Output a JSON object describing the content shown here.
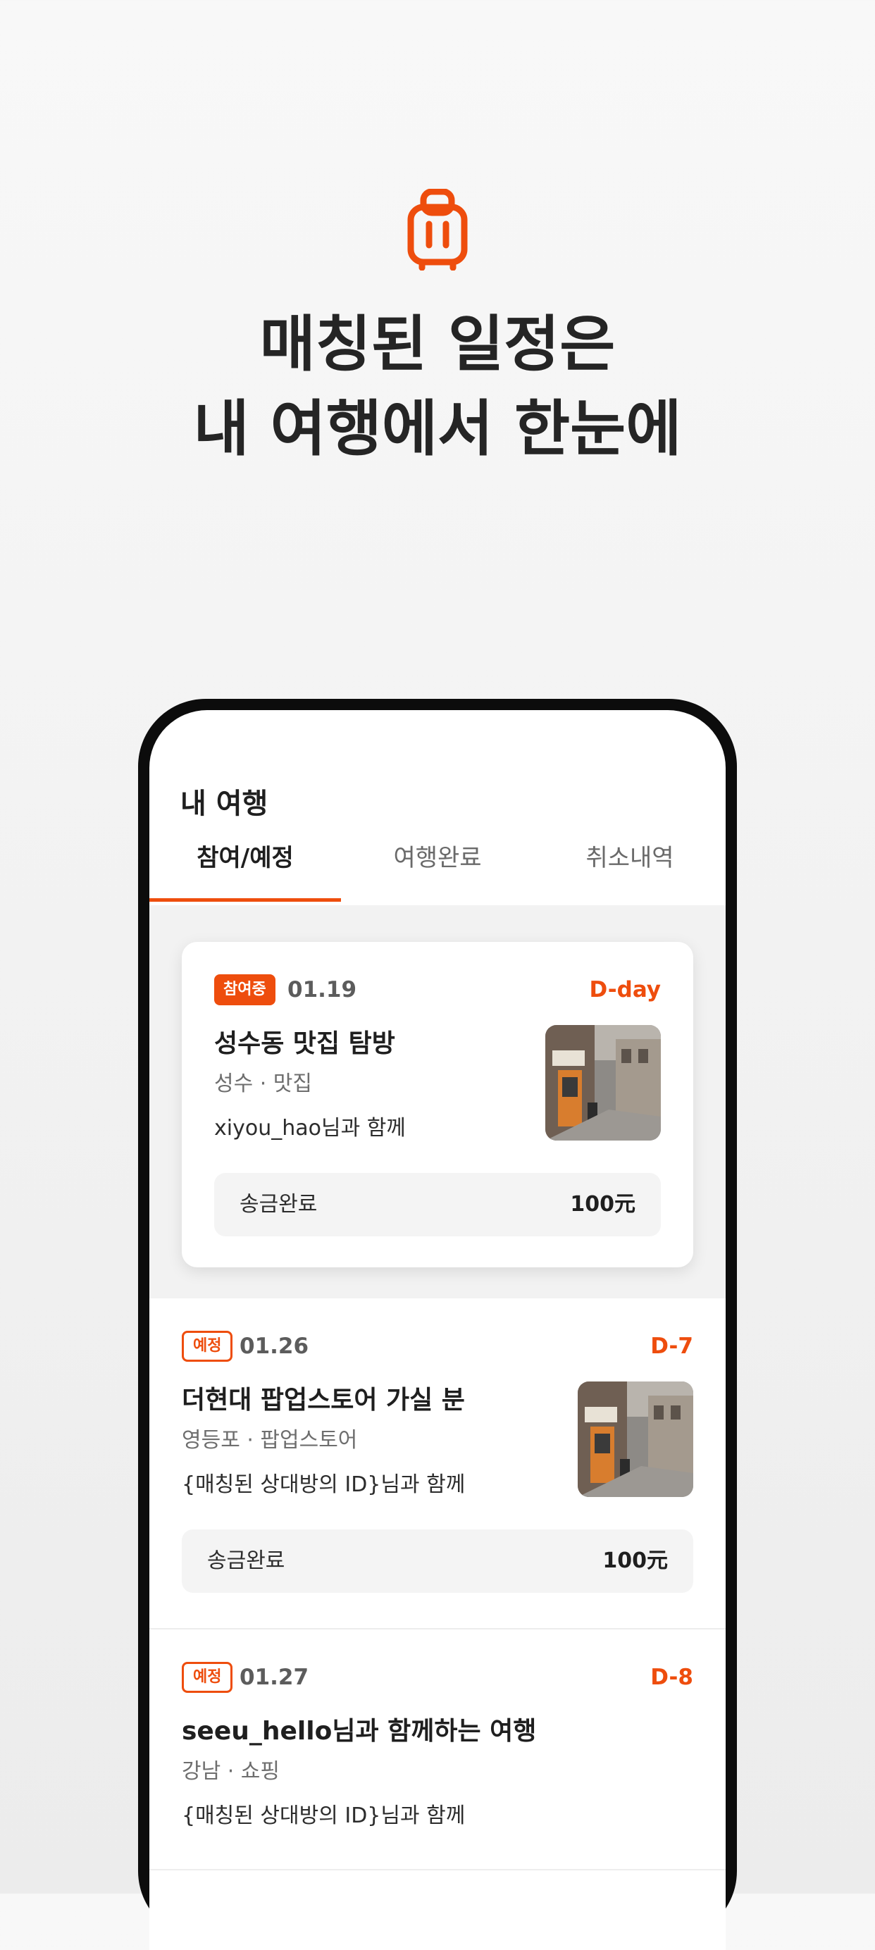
{
  "hero": {
    "icon": "luggage-icon",
    "title_line1": "매칭된 일정은",
    "title_line2": "내 여행에서 한눈에"
  },
  "screen": {
    "title": "내 여행",
    "tabs": [
      {
        "label": "참여/예정",
        "active": true
      },
      {
        "label": "여행완료",
        "active": false
      },
      {
        "label": "취소내역",
        "active": false
      }
    ],
    "trips": [
      {
        "badge": "참여중",
        "date": "01.19",
        "dday": "D-day",
        "title": "성수동 맛집 탐방",
        "subtitle": "성수 · 맛집",
        "with": "xiyou_hao님과 함께",
        "payment_label": "송금완료",
        "payment_amount": "100元"
      },
      {
        "badge": "예정",
        "date": "01.26",
        "dday": "D-7",
        "title": "더현대 팝업스토어 가실 분",
        "subtitle": "영등포 · 팝업스토어",
        "with": "{매칭된 상대방의 ID}님과 함께",
        "payment_label": "송금완료",
        "payment_amount": "100元"
      },
      {
        "badge": "예정",
        "date": "01.27",
        "dday": "D-8",
        "title": "seeu_hello님과 함께하는 여행",
        "subtitle": "강남 · 쇼핑",
        "with": "{매칭된 상대방의 ID}님과 함께"
      }
    ]
  },
  "colors": {
    "accent": "#ee4d0d",
    "text_primary": "#1f1f1f",
    "text_secondary": "#6e6e6e",
    "surface_gray": "#f4f4f4"
  }
}
